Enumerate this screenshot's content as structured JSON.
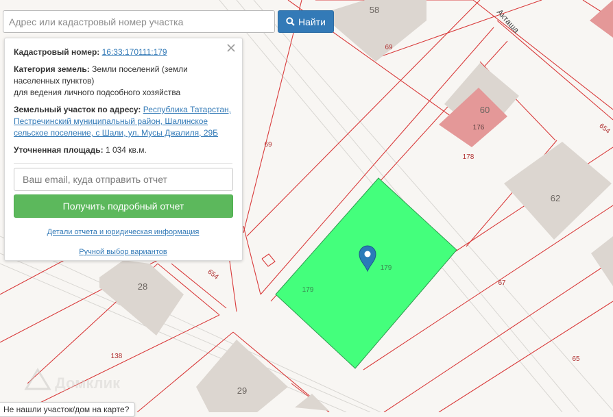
{
  "search": {
    "placeholder": "Адрес или кадастровый номер участка",
    "button_label": "Найти",
    "button_icon": "search-icon"
  },
  "panel": {
    "cadastral_label": "Кадастровый номер:",
    "cadastral_number": "16:33:170111:179",
    "land_category_label": "Категория земель:",
    "land_category_value": "Земли поселений (земли населенных пунктов)",
    "land_use": "для ведения личного подсобного хозяйства",
    "address_label": "Земельный участок по адресу:",
    "address_value": "Республика Татарстан, Пестречинский муниципальный район, Шалинское сельское поселение, с Шали, ул. Мусы Джалиля, 29Б",
    "area_label": "Уточненная площадь:",
    "area_value": "1 034 кв.м.",
    "email_placeholder": "Ваш email, куда отправить отчет",
    "report_button": "Получить подробный отчет",
    "details_link": "Детали отчета и юридическая информация",
    "manual_link": "Ручной выбор вариантов"
  },
  "map": {
    "street_label": "Акташа",
    "building_numbers": [
      "58",
      "60",
      "62",
      "28",
      "29",
      "176"
    ],
    "parcel_labels": [
      "69",
      "69",
      "654",
      "178",
      "179",
      "179",
      "67",
      "654",
      "138",
      "65"
    ],
    "selected_parcel_color": "#44ff7c",
    "boundary_color": "#d93b3b",
    "marker_color": "#2a7ab8",
    "watermark": "Домклик"
  },
  "hint": "Не нашли участок/дом на карте?"
}
